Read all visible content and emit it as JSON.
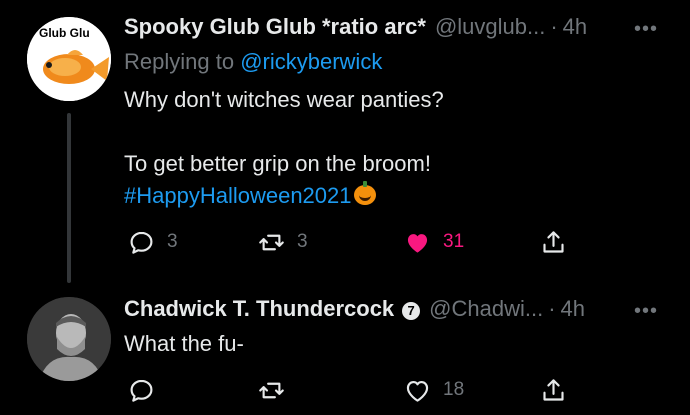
{
  "tweets": [
    {
      "display_name": "Spooky Glub Glub *ratio arc*",
      "handle": "@luvglub...",
      "separator": "·",
      "time": "4h",
      "more": "•••",
      "avatar_text": "Glub Glu",
      "replying_prefix": "Replying to",
      "replying_to": "@rickyberwick",
      "lines": [
        "Why don't witches wear panties?",
        "",
        "To get better grip on the broom!"
      ],
      "hashtag": "#HappyHalloween2021",
      "emoji_icon": "pumpkin-icon",
      "replies": "3",
      "retweets": "3",
      "likes": "31",
      "liked": true,
      "like_color": "#f91880"
    },
    {
      "display_name": "Chadwick T. Thundercock",
      "verified_glyph": "7",
      "handle": "@Chadwi...",
      "separator": "·",
      "time": "4h",
      "more": "•••",
      "text": "What the fu-",
      "replies": "",
      "retweets": "",
      "likes": "18",
      "liked": false
    }
  ],
  "colors": {
    "background": "#000000",
    "text": "#e7e9ea",
    "muted": "#71767b",
    "link": "#1d9bf0",
    "like": "#f91880"
  }
}
